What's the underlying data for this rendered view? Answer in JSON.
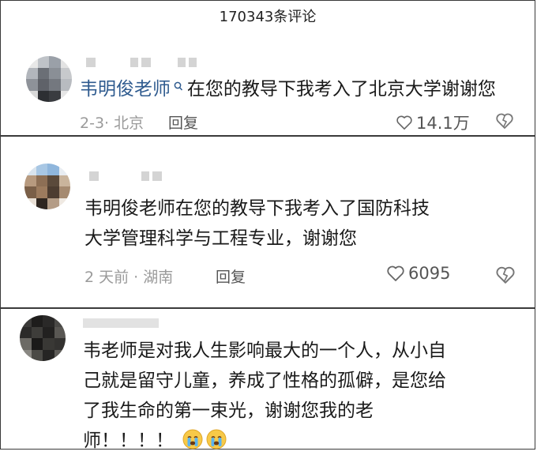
{
  "header": {
    "comment_count_title": "170343条评论"
  },
  "comments": [
    {
      "mention": "韦明俊老师",
      "text": "在您的教导下我考入了北京大学谢谢您",
      "date_location": "2-3· 北京",
      "reply_label": "回复",
      "likes": "14.1万"
    },
    {
      "line1": "韦明俊老师在您的教导下我考入了国防科技",
      "line2": "大学管理科学与工程专业，谢谢您",
      "date_location": "2 天前 · 湖南",
      "reply_label": "回复",
      "likes": "6095"
    },
    {
      "line1": "韦老师是对我人生影响最大的一个人，从小自",
      "line2": "己就是留守儿童，养成了性格的孤僻，是您给",
      "line3": "了我生命的第一束光，谢谢您我的老",
      "line4": "师！！！！",
      "emojis": [
        "crying-emoji",
        "crying-emoji"
      ]
    }
  ],
  "colors": {
    "mention": "#2f5b8f",
    "meta": "#9a9a9a",
    "border": "#3a3a3a"
  }
}
